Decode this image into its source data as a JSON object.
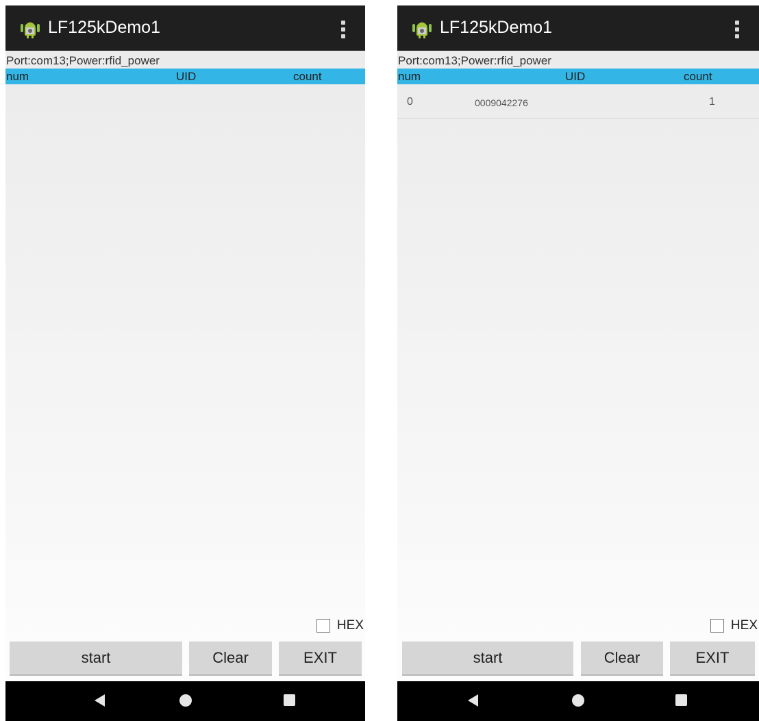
{
  "screens": [
    {
      "app_title": "LF125kDemo1",
      "port_info": "Port:com13;Power:rfid_power",
      "columns": {
        "num": "num",
        "uid": "UID",
        "count": "count"
      },
      "rows": [],
      "hex_label": "HEX",
      "hex_checked": false,
      "buttons": {
        "start": "start",
        "clear": "Clear",
        "exit": "EXIT"
      }
    },
    {
      "app_title": "LF125kDemo1",
      "port_info": "Port:com13;Power:rfid_power",
      "columns": {
        "num": "num",
        "uid": "UID",
        "count": "count"
      },
      "rows": [
        {
          "num": "0",
          "uid": "0009042276",
          "count": "1"
        }
      ],
      "hex_label": "HEX",
      "hex_checked": false,
      "buttons": {
        "start": "start",
        "clear": "Clear",
        "exit": "EXIT"
      }
    }
  ],
  "colors": {
    "action_bar": "#1f1f1f",
    "table_header": "#33b5e5",
    "button": "#d6d6d6",
    "nav_bar": "#000000"
  },
  "icons": [
    "android-app-icon",
    "overflow-menu-icon",
    "back-icon",
    "home-icon",
    "recents-icon"
  ]
}
